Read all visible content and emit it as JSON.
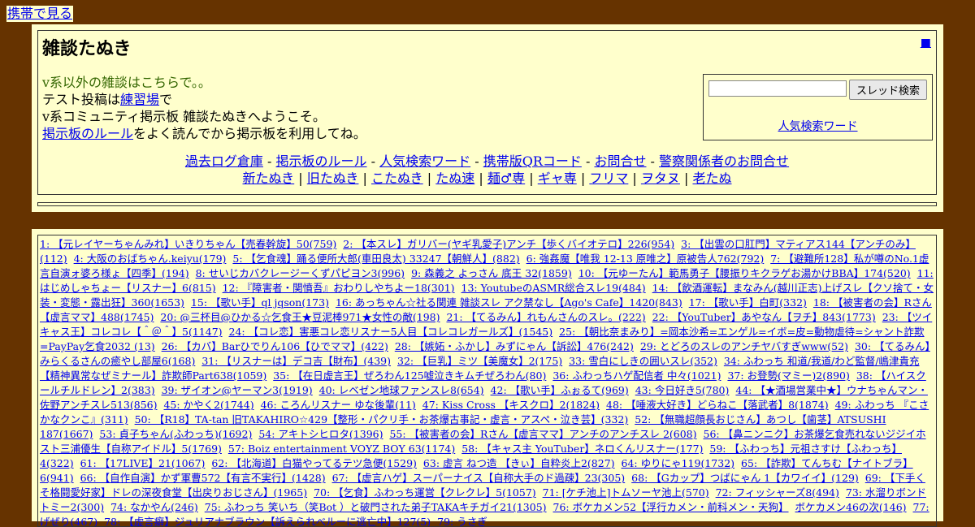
{
  "mobile_link": "携帯で見る",
  "board": {
    "title": "雑談たぬき",
    "corner_icon": "■"
  },
  "intro": {
    "line1": "v系以外の雑談はこちらで。。",
    "line2_prefix": "テスト投稿は",
    "line2_link": "練習場",
    "line2_suffix": "で",
    "line3": "v系コミュニティ掲示板 雑談たぬきへようこそ。",
    "line4_link": "掲示板のルール",
    "line4_suffix": "をよく読んでから掲示板を利用してね。"
  },
  "search": {
    "input_value": "",
    "button_label": "スレッド検索",
    "popular_link": "人気検索ワード"
  },
  "nav1": {
    "items": [
      "過去ログ倉庫",
      "掲示板のルール",
      "人気検索ワード",
      "携帯版QRコード",
      "お問合せ",
      "警察関係者のお問合せ"
    ],
    "separator": " - "
  },
  "nav2": {
    "items": [
      "新たぬき",
      "旧たぬき",
      "こたぬき",
      "たぬ速",
      "麺♂専",
      "ギャ専",
      "フリマ",
      "ヲタヌ",
      "老たぬ"
    ],
    "separator": " | "
  },
  "threads": [
    "1: 【元レイヤーちゃんみれ】いきりちゃん【売春幹旋】50(759)",
    "2: 【本スレ】ガリバー(ヤギ乳愛子)アンチ【歩くバイオテロ】226(954)",
    "3: 【出雲の口肛門】マティアス144【アンチのみ】(112)",
    "4: 大阪のおばちゃん.keiyu(179)",
    "5: 【乞食魂】踊る便所大郎(車田良太) 33247【朝鮮人】(882)",
    "6: 強姦魔【唯我 12-13 原唯之】原被告人762(792)",
    "7: 【避難所128】私が噂のNo.1虚言自演ォ婆ろ様ょ【四季】(194)",
    "8: せいじカバクレージーくずパピヨン3(996)",
    "9: 森義之 よっさん 底王 32(1859)",
    "10: 【元ゆーたん】範馬勇子【腰振りキクラゲお湯かけBBA】174(520)",
    "11: はじめしゃちょー【リスナー】6(815)",
    "12: 『障害者・関憤吾』おわりしやちよー18(301)",
    "13: YoutubeのASMR総合スレ19(484)",
    "14: 【飲酒運転】まなみん(越川正志)上げスレ【クソ捨て・女装・変態・露出狂】360(1653)",
    "15: 【歌い手】ql jqson(173)",
    "16: あっちゃん☆社る関連 雑談スレ アク禁なし【Ago's Cafe】1420(843)",
    "17: 【歌い手】白町(332)",
    "18: 【被害者の会】Rさん【虚言ママ】488(1745)",
    "20: @三杯目@ひかる☆乞食王★豆泥棒971★女性の敵(198)",
    "21: 【てるみん】れもんさんのスレ。(222)",
    "22: 【YouTuber】あやなん【ヲチ】843(1773)",
    "23: 【ツイキャス王】コレコレ【＾＠＾】5(1147)",
    "24: 【コレ恋】害悪コレ恋リスナー5人目【コレコレガールズ】(1545)",
    "25: 【朝比奈まみり】=岡本沙希=エンゲル=イボ=皮=動物虐待=シャント詐欺=PayPay乞食2032 (13)",
    "26: 【カバ】Barひでりん106【ひでママ】(422)",
    "28: 【嫉妬・ふかし】みずにゃん【訴訟】476(242)",
    "29: とどろのスレのアンチヤバすぎwww(52)",
    "30: 【てるみん】みらくるさんの癒やし部屋6(168)",
    "31: 【リスナーは】デコ吉【財布】(439)",
    "32: 【巨乳】ミツ【美魔女】2(175)",
    "33: 雪白にしきの囲いスレ(352)",
    "34: ふわっち 和道/我道/わど監督/嶋津貴充【精神異常なぜミナール】詐欺師Part638(1059)",
    "35: 【在日虚言王】ぜろわん125嘘泣きキムチぜろわん(80)",
    "36: ふわっちハゲ配信者 中々(1021)",
    "37: お登勢(マミー)2(890)",
    "38: 【ハイスクールチルドレン】2(383)",
    "39: ザイオン@ヤーマン3(1919)",
    "40: レベゼン地球ファンスレ8(654)",
    "42: 【歌い手】ふぉるて(969)",
    "43: 今日好き5(780)",
    "44: 【★酒場営業中★】ウナちゃんマン・佐野アンチスレ513(856)",
    "45: かやく2(1744)",
    "46: ころんリスナー ゆな後輩(11)",
    "47: Kiss Cross 【キスクロ】2(1824)",
    "48: 【唾液大好き】どらねこ【落武者】8(1874)",
    "49: ふわっち 『こさかなクンこ』(311)",
    "50: 【R18】TA-tan 旧TAKAHIRO☆429【整形・パクリ手・お茶爆古事記・虚言・アスペ・泣き芸】(332)",
    "52: 【無職超顔長おじさん】あつし【歯茎】ATSUSHI 187(1667)",
    "53: 貞子ちゃん(ふわっち)(1692)",
    "54: アキトシヒロタ(1396)",
    "55: 【被害者の会】Rさん【虚言ママ】アンチのアンチスレ 2(608)",
    "56: 【鼻ニンニク】お茶爆乞食売れないジジイホスト三浦優生【自称アイドル】5(1769)",
    "57: Boiz entertainment VOYZ BOY 63(1174)",
    "58: 【キャス主 YouTuber】ネロくんリスナー(177)",
    "59: 【ふわっち】元祖さすけ【ふわっち】4(322)",
    "61: 【17LIVE】21(1067)",
    "62: 【北海道】白猫やってるテツ急便(1529)",
    "63: 虚言 ねつ造 【きぃ】自粋炎上2(827)",
    "64: ゆりにゃ119(1732)",
    "65: 【詐欺】てんちむ【ナイトブラ】6(941)",
    "66: 【自作自演】かず軍曹572【有言不実行】(1428)",
    "67: 【虚言ハゲ】スーパーナイス【自称大手のド過疎】23(305)",
    "68: 【Gカップ】つばにゃん 1【カワイイ】(129)",
    "69: 【下手くそ格闘愛好家】ドレの深夜食堂【出戻りおじさん】(1965)",
    "70: 【乞食】ふわっち運営【クレクレ】5(1057)",
    "71: [ケチ池上]トムソーヤ池上(570)",
    "72: フィッシャーズ8(494)",
    "73: 水溜りボンド トミー2(300)",
    "74: なかやん(246)",
    "75: ふわっち 笑いち（笑Bot ）と破門された弟子TAKAキチガイ21(1305)",
    "76: ボケカメン52【浮行カメン・前科メン・天狗】",
    "ボケカメン46の次(146)",
    "77: げぜり(467)",
    "78: 【虚言癖】ジュリアナブラウン【訴えられべルーに逃亡中】127(5)",
    "79: うさぎ"
  ]
}
